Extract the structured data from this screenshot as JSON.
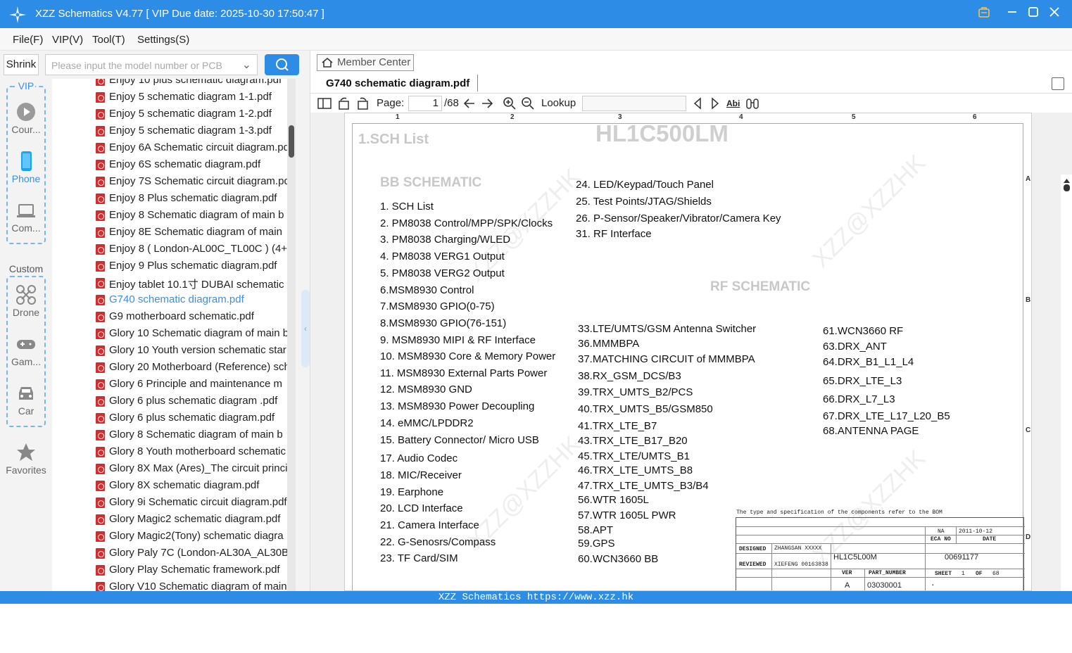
{
  "app": {
    "title": "XZZ Schematics V4.77 [ VIP Due date: 2025-10-30 17:50:47 ]"
  },
  "menu": [
    "File(F)",
    "VIP(V)",
    "Tool(T)",
    "Settings(S)"
  ],
  "left": {
    "shrink_label": "Shrink",
    "search_placeholder": "Please input the model number or PCB",
    "rail": {
      "vip_label": "VIP",
      "custom_label": "Custom",
      "items": [
        "Cour...",
        "Phone",
        "Com...",
        "Drone",
        "Gam...",
        "Car",
        "Favorites"
      ]
    },
    "files": [
      "Enjoy 10 plus schematic diagram.pdf",
      "Enjoy 5 schematic diagram 1-1.pdf",
      "Enjoy 5 schematic diagram 1-2.pdf",
      "Enjoy 5 schematic diagram 1-3.pdf",
      "Enjoy 6A Schematic circuit diagram.pdf",
      "Enjoy 6S schematic diagram.pdf",
      "Enjoy 7S Schematic circuit diagram.pdf",
      "Enjoy 8 Plus schematic diagram.pdf",
      "Enjoy 8 Schematic diagram of main b",
      "Enjoy 8E Schematic diagram of main",
      "Enjoy 8 ( London-AL00C_TL00C ) (4+6",
      "Enjoy 9 Plus schematic diagram.pdf",
      "Enjoy tablet 10.1寸 DUBAI schematic c",
      "G740 schematic diagram.pdf",
      "G9 motherboard schematic.pdf",
      "Glory 10 Schematic diagram of main b",
      "Glory 10 Youth version schematic star",
      "Glory 20 Motherboard (Reference) sch",
      "Glory 6 Principle and maintenance m",
      "Glory 6 plus schematic diagram .pdf",
      "Glory 6 plus schematic diagram.pdf",
      "Glory 8 Schematic diagram of main b",
      "Glory 8 Youth motherboard schematic",
      "Glory 8X Max (Ares)_The circuit princi",
      "Glory 8X schematic diagram.pdf",
      "Glory 9i Schematic circuit diagram.pdf",
      "Glory Magic2 schematic diagram.pdf",
      "Glory Magic2(Tony) schematic diagra",
      "Glory Paly 7C (London-AL30A_AL30B_",
      "Glory Play Schematic framework.pdf",
      "Glory V10 Schematic diagram of main"
    ],
    "selected_index": 13
  },
  "right": {
    "member_center": "Member Center",
    "tab_title": "G740 schematic diagram.pdf",
    "toolbar": {
      "page_label": "Page:",
      "page_value": "1",
      "page_total": "/68",
      "lookup_label": "Lookup",
      "abi": "Abi"
    }
  },
  "schematic": {
    "col_marks": [
      "1",
      "2",
      "3",
      "4",
      "5",
      "6"
    ],
    "row_marks": [
      "A",
      "B",
      "C",
      "D"
    ],
    "sch_list": "1.SCH List",
    "model": "HL1C500LM",
    "bb_heading": "BB SCHEMATIC",
    "rf_heading": "RF SCHEMATIC",
    "col1": [
      "1. SCH List",
      "2. PM8038 Control/MPP/SPK/Clocks",
      "3. PM8038 Charging/WLED",
      "4. PM8038 VERG1 Output",
      "5. PM8038 VERG2 Output",
      "6.MSM8930 Control",
      "7.MSM8930 GPIO(0-75)",
      "8.MSM8930 GPIO(76-151)",
      "9. MSM8930 MIPI & RF Interface",
      "10. MSM8930 Core & Memory Power",
      "11. MSM8930 External Parts Power",
      "12. MSM8930 GND",
      "13. MSM8930 Power Decoupling",
      "14. eMMC/LPDDR2",
      "15. Battery Connector/ Micro USB",
      "17. Audio Codec",
      "18. MIC/Receiver",
      "19. Earphone",
      "20. LCD Interface",
      "21. Camera Interface",
      "22. G-Senosrs/Compass",
      "23. TF Card/SIM"
    ],
    "col2_top": [
      "24. LED/Keypad/Touch Panel",
      "25. Test Points/JTAG/Shields",
      "26. P-Sensor/Speaker/Vibrator/Camera Key",
      "31. RF Interface"
    ],
    "col2": [
      "33.LTE/UMTS/GSM Antenna Switcher",
      "36.MMMBPA",
      "37.MATCHING CIRCUIT of MMMBPA",
      "38.RX_GSM_DCS/B3",
      "39.TRX_UMTS_B2/PCS",
      "40.TRX_UMTS_B5/GSM850",
      "41.TRX_LTE_B7",
      "43.TRX_LTE_B17_B20",
      "45.TRX_LTE/UMTS_B1",
      "46.TRX_LTE_UMTS_B8",
      "47.TRX_LTE_UMTS_B3/B4",
      "56.WTR 1605L",
      "57.WTR 1605L PWR",
      "58.APT",
      "59.GPS",
      "60.WCN3660 BB"
    ],
    "col3": [
      "61.WCN3660 RF",
      "63.DRX_ANT",
      "64.DRX_B1_L1_L4",
      "65.DRX_LTE_L3",
      "66.DRX_L7_L3",
      "67.DRX_LTE_L17_L20_B5",
      "68.ANTENNA PAGE"
    ],
    "watermark": "XZZ@XZZHK",
    "titleblock": {
      "note": "The type and specification of the components  refer to the BOM",
      "na": "NA",
      "date_val": "2011-10-12",
      "eca_no": "ECA NO",
      "date": "DATE",
      "designed": "DESIGNED",
      "designer": "ZHANGSAN XXXXX",
      "part": "HL1C5L00M",
      "number": "00691177",
      "reviewed": "REVIEWED",
      "reviewer": "XIEFENG 00163838",
      "ver": "VER",
      "part_number": "PART_NUMBER",
      "sheet": "SHEET",
      "sheet_val": "1",
      "of": "OF",
      "of_val": "68",
      "ver_val": "A",
      "pn_val": "03030001",
      "dot": "."
    }
  },
  "status": "XZZ Schematics https://www.xzz.hk"
}
